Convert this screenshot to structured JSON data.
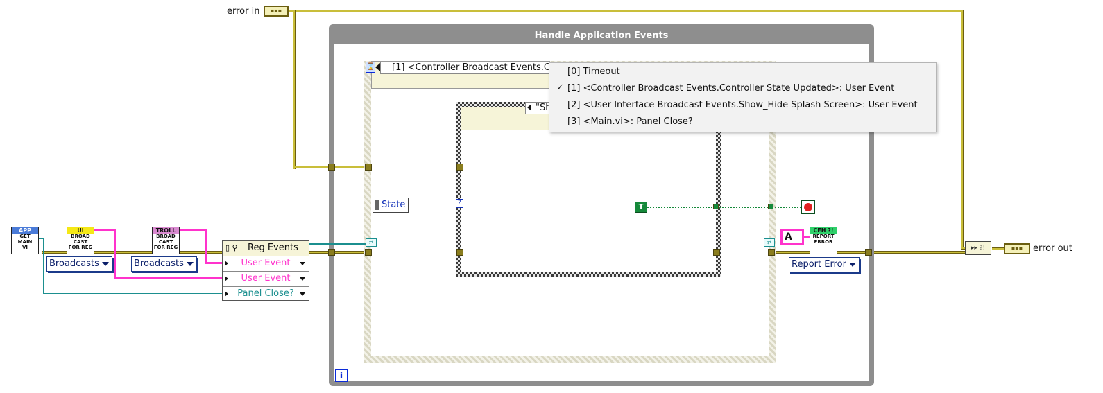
{
  "error_in": {
    "label": "error in"
  },
  "error_out": {
    "label": "error out"
  },
  "while_loop": {
    "title": "Handle Application Events",
    "iteration_glyph": "i"
  },
  "event_structure": {
    "selector_text": "[1] <Controller Broadcast Events.C",
    "menu_items": [
      {
        "label": "[0] Timeout",
        "checked": false
      },
      {
        "label": "[1] <Controller Broadcast Events.Controller State Updated>: User Event",
        "checked": true
      },
      {
        "label": "[2] <User Interface Broadcast Events.Show_Hide Splash Screen>: User Event",
        "checked": false
      },
      {
        "label": "[3] <Main.vi>: Panel Close?",
        "checked": false
      }
    ],
    "check_glyph": "✓"
  },
  "case_structure": {
    "selector_text": "\"Sh"
  },
  "state_control": {
    "label": "State"
  },
  "bool_constant": {
    "label": "T"
  },
  "nodes": {
    "get_main": {
      "band": "APP",
      "lines": [
        "GET",
        "MAIN",
        "VI"
      ],
      "band_color": "#4a7bd8"
    },
    "ui_broadcast": {
      "band": "UI",
      "lines": [
        "BROAD",
        "CAST",
        "FOR REG"
      ],
      "band_color": "#f5e816"
    },
    "troll_broadcast": {
      "band": "TROLL",
      "lines": [
        "BROAD",
        "CAST",
        "FOR REG"
      ],
      "band_color": "#d98ad0"
    },
    "report_error": {
      "band": "CEH ?!",
      "lines": [
        "REPORT",
        "ERROR"
      ],
      "band_color": "#2fd06a"
    }
  },
  "rings": {
    "broadcasts_1": "Broadcasts",
    "broadcasts_2": "Broadcasts",
    "report_error": "Report Error"
  },
  "reg_events": {
    "title": "Reg Events",
    "rows": [
      {
        "label": "User Event",
        "color": "#ff33cc"
      },
      {
        "label": "User Event",
        "color": "#ff33cc"
      },
      {
        "label": "Panel Close?",
        "color": "#1b8f8f"
      }
    ]
  },
  "string_constant": {
    "label": "A"
  },
  "colors": {
    "error_wire": "#c9be3a",
    "event_wire": "#ff33cc",
    "ref_wire": "#1b8f8f",
    "loop_frame": "#8e8e8e"
  }
}
